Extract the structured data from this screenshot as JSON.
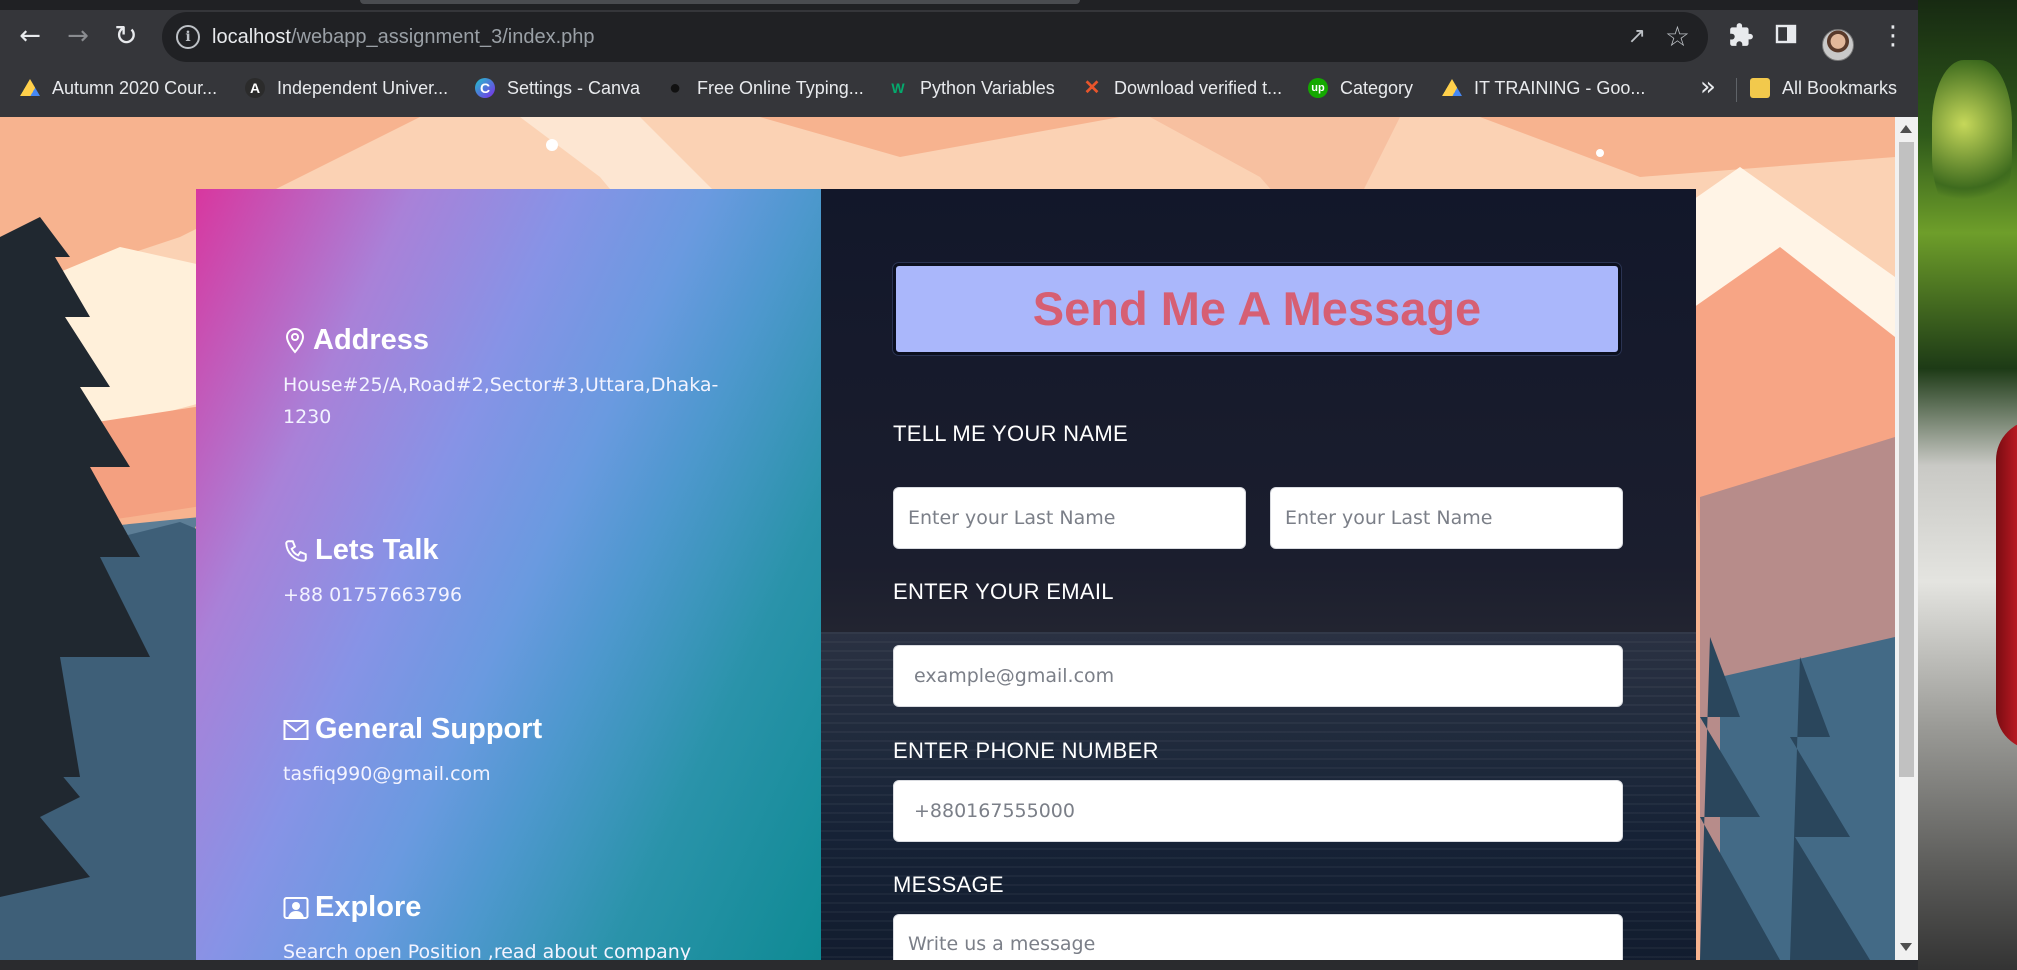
{
  "browser": {
    "url_host": "localhost",
    "url_path": "/webapp_assignment_3/index.php",
    "bookmarks": [
      {
        "label": "Autumn 2020 Cour...",
        "icon": "google-drive-icon"
      },
      {
        "label": "Independent Univer...",
        "icon": "angular-icon"
      },
      {
        "label": "Settings - Canva",
        "icon": "canva-icon"
      },
      {
        "label": "Free Online Typing...",
        "icon": "paw-icon"
      },
      {
        "label": "Python Variables",
        "icon": "w3schools-icon"
      },
      {
        "label": "Download verified t...",
        "icon": "x-icon"
      },
      {
        "label": "Category",
        "icon": "upwork-icon"
      },
      {
        "label": "IT TRAINING - Goo...",
        "icon": "google-drive-icon"
      }
    ],
    "more_bookmarks": "»",
    "all_bookmarks": "All Bookmarks"
  },
  "contact_info": {
    "address": {
      "title": "Address",
      "text": "House#25/A,Road#2,Sector#3,Uttara,Dhaka-1230",
      "icon": "map-pin-icon"
    },
    "talk": {
      "title": "Lets Talk",
      "text": "+88 01757663796",
      "icon": "phone-icon"
    },
    "support": {
      "title": "General Support",
      "text": "tasfiq990@gmail.com",
      "icon": "envelope-icon"
    },
    "explore": {
      "title": "Explore",
      "text": "Search open Position ,read about company",
      "icon": "person-card-icon"
    }
  },
  "form": {
    "heading": "Send Me A Message",
    "name_label": "TELL ME YOUR NAME",
    "first_name_placeholder": "Enter your Last Name",
    "last_name_placeholder": "Enter your Last Name",
    "email_label": "ENTER YOUR EMAIL",
    "email_placeholder": "example@gmail.com",
    "phone_label": "ENTER PHONE NUMBER",
    "phone_placeholder": "+880167555000",
    "message_label": "MESSAGE",
    "message_placeholder": "Write us a message"
  },
  "colors": {
    "heading_bg": "#aab7fb",
    "heading_text": "#d65f73",
    "form_bg": "#151a2b",
    "page_bg": "#f8b894"
  }
}
